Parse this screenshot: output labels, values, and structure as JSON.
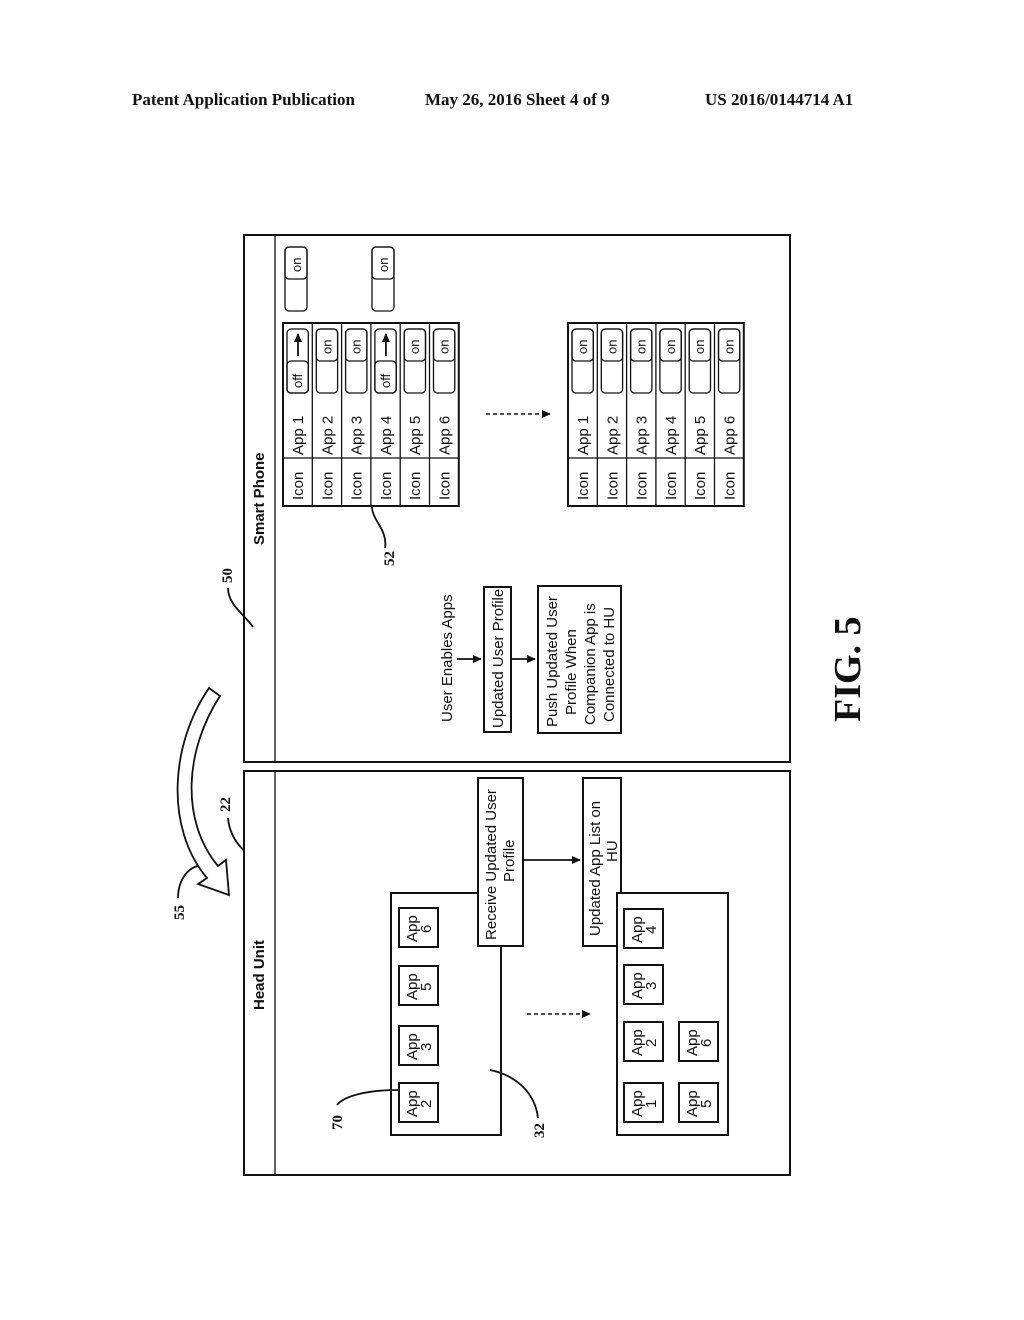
{
  "header": {
    "publication": "Patent Application Publication",
    "date_sheet": "May 26, 2016  Sheet 4 of 9",
    "number": "US 2016/0144714 A1"
  },
  "figure": {
    "label": "FIG. 5",
    "orientation": "rotated 90° counter-clockwise",
    "refs": {
      "smart_phone": "50",
      "app_list": "52",
      "transfer_arrow": "55",
      "head_unit": "22",
      "hu_app_list": "32",
      "app_tile": "70"
    },
    "smart_phone": {
      "title": "Smart Phone",
      "flow": {
        "step1": "User Enables Apps",
        "step2": "Updated User Profile",
        "step3_lines": [
          "Push Updated User",
          "Profile When",
          "Companion App is",
          "Connected to HU"
        ]
      },
      "legend_toggles": [
        {
          "label": "on"
        },
        {
          "label": "on"
        }
      ],
      "before_list": [
        {
          "icon": "Icon",
          "app": "App 1",
          "toggle": "off",
          "changing": true
        },
        {
          "icon": "Icon",
          "app": "App 2",
          "toggle": "on",
          "changing": false
        },
        {
          "icon": "Icon",
          "app": "App 3",
          "toggle": "on",
          "changing": false
        },
        {
          "icon": "Icon",
          "app": "App 4",
          "toggle": "off",
          "changing": true
        },
        {
          "icon": "Icon",
          "app": "App 5",
          "toggle": "on",
          "changing": false
        },
        {
          "icon": "Icon",
          "app": "App 6",
          "toggle": "on",
          "changing": false
        }
      ],
      "after_list": [
        {
          "icon": "Icon",
          "app": "App 1",
          "toggle": "on"
        },
        {
          "icon": "Icon",
          "app": "App 2",
          "toggle": "on"
        },
        {
          "icon": "Icon",
          "app": "App 3",
          "toggle": "on"
        },
        {
          "icon": "Icon",
          "app": "App 4",
          "toggle": "on"
        },
        {
          "icon": "Icon",
          "app": "App 5",
          "toggle": "on"
        },
        {
          "icon": "Icon",
          "app": "App 6",
          "toggle": "on"
        }
      ]
    },
    "head_unit": {
      "title": "Head Unit",
      "receive_lines": [
        "Receive Updated User",
        "Profile"
      ],
      "update_lines": [
        "Updated App List on",
        "HU"
      ],
      "before_apps": [
        {
          "word": "App",
          "num": "2"
        },
        {
          "word": "App",
          "num": "3"
        },
        {
          "word": "App",
          "num": "5"
        },
        {
          "word": "App",
          "num": "6"
        }
      ],
      "after_apps_row1": [
        {
          "word": "App",
          "num": "1"
        },
        {
          "word": "App",
          "num": "2"
        },
        {
          "word": "App",
          "num": "3"
        },
        {
          "word": "App",
          "num": "4"
        }
      ],
      "after_apps_row2": [
        {
          "word": "App",
          "num": "5"
        },
        {
          "word": "App",
          "num": "6"
        }
      ]
    }
  }
}
